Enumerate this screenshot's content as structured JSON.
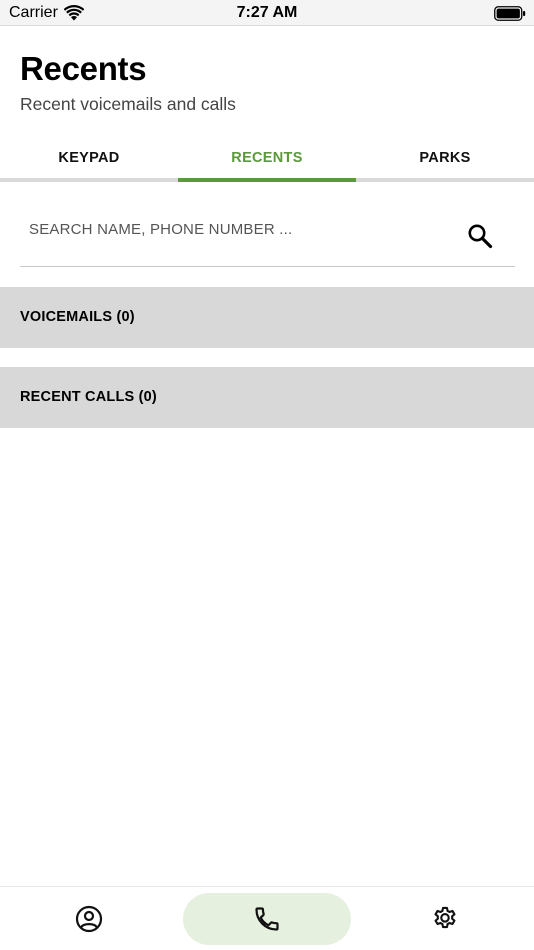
{
  "status_bar": {
    "carrier": "Carrier",
    "time": "7:27 AM",
    "icons": [
      "wifi-icon",
      "battery-icon"
    ]
  },
  "header": {
    "title": "Recents",
    "subtitle": "Recent voicemails and calls"
  },
  "tabs": [
    {
      "label": "KEYPAD",
      "active": false
    },
    {
      "label": "RECENTS",
      "active": true
    },
    {
      "label": "PARKS",
      "active": false
    }
  ],
  "search": {
    "placeholder": "SEARCH NAME, PHONE NUMBER ...",
    "value": "",
    "icon": "search-icon"
  },
  "sections": {
    "voicemails": "VOICEMAILS (0)",
    "recent_calls": "RECENT CALLS (0)"
  },
  "bottom_nav": [
    {
      "icon": "profile-icon",
      "active": false
    },
    {
      "icon": "phone-icon",
      "active": true
    },
    {
      "icon": "gear-icon",
      "active": false
    }
  ],
  "colors": {
    "accent": "#5a9a3a",
    "section_bg": "#d8d8d8",
    "active_nav_bg": "#e6f0df"
  }
}
